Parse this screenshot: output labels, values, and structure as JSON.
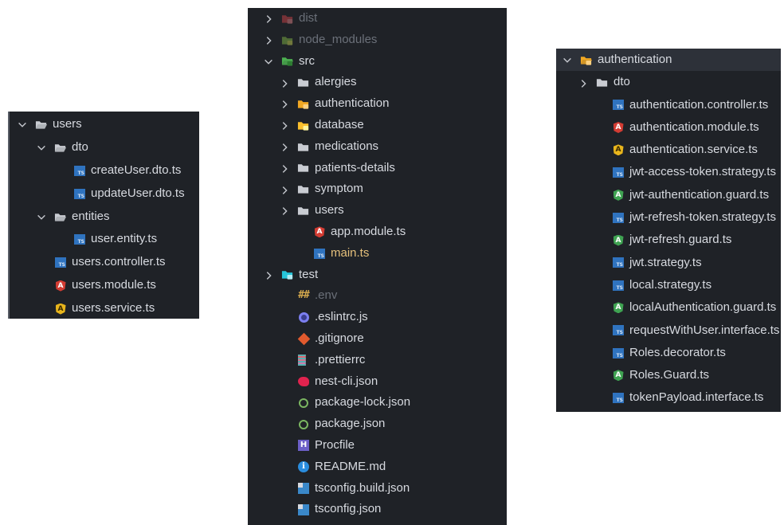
{
  "colors": {
    "panel_bg": "#1f2227",
    "text": "#d7dae0",
    "dim": "#6b7079",
    "modified": "#e5c07b",
    "ts_blue": "#2f73bf"
  },
  "left_panel": {
    "rows": [
      {
        "label": "users",
        "kind": "folder-open",
        "chevron": "down",
        "depth": 0
      },
      {
        "label": "dto",
        "kind": "folder-open",
        "chevron": "down",
        "depth": 1
      },
      {
        "label": "createUser.dto.ts",
        "kind": "ts",
        "depth": 2
      },
      {
        "label": "updateUser.dto.ts",
        "kind": "ts",
        "depth": 2
      },
      {
        "label": "entities",
        "kind": "folder-open",
        "chevron": "down",
        "depth": 1
      },
      {
        "label": "user.entity.ts",
        "kind": "ts",
        "depth": 2
      },
      {
        "label": "users.controller.ts",
        "kind": "ts",
        "depth": 1
      },
      {
        "label": "users.module.ts",
        "kind": "angular-red",
        "depth": 1
      },
      {
        "label": "users.service.ts",
        "kind": "angular-yellow",
        "depth": 1
      }
    ]
  },
  "middle_panel": {
    "rows": [
      {
        "label": "dist",
        "kind": "folder-dist",
        "chevron": "right",
        "depth": 0,
        "dim": true
      },
      {
        "label": "node_modules",
        "kind": "folder-node",
        "chevron": "right",
        "depth": 0,
        "dim": true
      },
      {
        "label": "src",
        "kind": "folder-src",
        "chevron": "down",
        "depth": 0
      },
      {
        "label": "alergies",
        "kind": "folder",
        "chevron": "right",
        "depth": 1
      },
      {
        "label": "authentication",
        "kind": "folder-auth",
        "chevron": "right",
        "depth": 1
      },
      {
        "label": "database",
        "kind": "folder-db",
        "chevron": "right",
        "depth": 1
      },
      {
        "label": "medications",
        "kind": "folder",
        "chevron": "right",
        "depth": 1
      },
      {
        "label": "patients-details",
        "kind": "folder",
        "chevron": "right",
        "depth": 1
      },
      {
        "label": "symptom",
        "kind": "folder",
        "chevron": "right",
        "depth": 1
      },
      {
        "label": "users",
        "kind": "folder",
        "chevron": "right",
        "depth": 1
      },
      {
        "label": "app.module.ts",
        "kind": "angular-red",
        "depth": 2
      },
      {
        "label": "main.ts",
        "kind": "ts",
        "depth": 2,
        "modified": true
      },
      {
        "label": "test",
        "kind": "folder-test",
        "chevron": "right",
        "depth": 0
      },
      {
        "label": ".env",
        "kind": "env",
        "depth": 1,
        "dim": true
      },
      {
        "label": ".eslintrc.js",
        "kind": "eslint",
        "depth": 1
      },
      {
        "label": ".gitignore",
        "kind": "git",
        "depth": 1
      },
      {
        "label": ".prettierrc",
        "kind": "prettier",
        "depth": 1
      },
      {
        "label": "nest-cli.json",
        "kind": "nest",
        "depth": 1
      },
      {
        "label": "package-lock.json",
        "kind": "node-json",
        "depth": 1
      },
      {
        "label": "package.json",
        "kind": "node-json",
        "depth": 1
      },
      {
        "label": "Procfile",
        "kind": "procfile",
        "depth": 1
      },
      {
        "label": "README.md",
        "kind": "info",
        "depth": 1
      },
      {
        "label": "tsconfig.build.json",
        "kind": "tsconfig",
        "depth": 1
      },
      {
        "label": "tsconfig.json",
        "kind": "tsconfig",
        "depth": 1
      }
    ]
  },
  "right_panel": {
    "rows": [
      {
        "label": "authentication",
        "kind": "folder-auth-open",
        "chevron": "down",
        "depth": 0,
        "selected": true
      },
      {
        "label": "dto",
        "kind": "folder",
        "chevron": "right",
        "depth": 1
      },
      {
        "label": "authentication.controller.ts",
        "kind": "ts",
        "depth": 2
      },
      {
        "label": "authentication.module.ts",
        "kind": "angular-red",
        "depth": 2
      },
      {
        "label": "authentication.service.ts",
        "kind": "angular-yellow",
        "depth": 2
      },
      {
        "label": "jwt-access-token.strategy.ts",
        "kind": "ts",
        "depth": 2
      },
      {
        "label": "jwt-authentication.guard.ts",
        "kind": "angular-green",
        "depth": 2
      },
      {
        "label": "jwt-refresh-token.strategy.ts",
        "kind": "ts",
        "depth": 2
      },
      {
        "label": "jwt-refresh.guard.ts",
        "kind": "angular-green",
        "depth": 2
      },
      {
        "label": "jwt.strategy.ts",
        "kind": "ts",
        "depth": 2
      },
      {
        "label": "local.strategy.ts",
        "kind": "ts",
        "depth": 2
      },
      {
        "label": "localAuthentication.guard.ts",
        "kind": "angular-green",
        "depth": 2
      },
      {
        "label": "requestWithUser.interface.ts",
        "kind": "ts",
        "depth": 2
      },
      {
        "label": "Roles.decorator.ts",
        "kind": "ts",
        "depth": 2
      },
      {
        "label": "Roles.Guard.ts",
        "kind": "angular-green",
        "depth": 2
      },
      {
        "label": "tokenPayload.interface.ts",
        "kind": "ts",
        "depth": 2
      }
    ]
  }
}
